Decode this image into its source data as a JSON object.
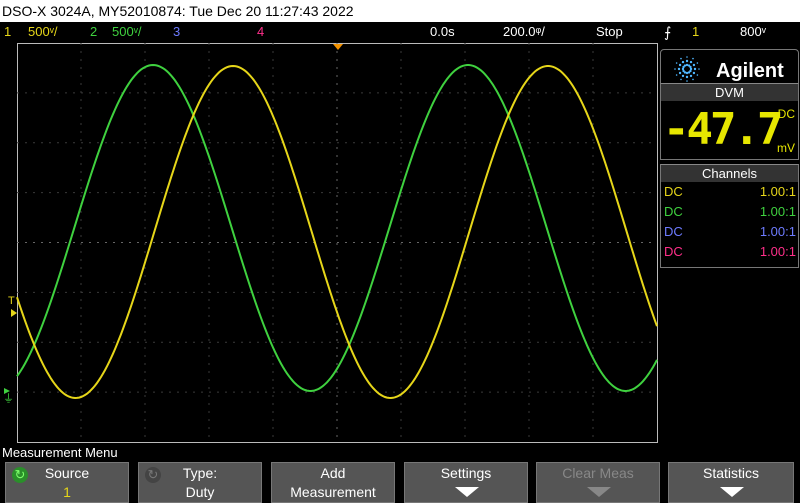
{
  "title": "DSO-X 3024A, MY52010874: Tue Dec 20 11:27:43 2022",
  "status": {
    "ch1_num": "1",
    "ch1_scale": "500ᵛ/",
    "ch2_num": "2",
    "ch2_scale": "500ᵛ/",
    "ch3_num": "3",
    "ch4_num": "4",
    "time_delay": "0.0s",
    "time_scale": "200.0ᵠ/",
    "run_state": "Stop",
    "trigger_source": "1",
    "trigger_level": "800ᵛ"
  },
  "markers": {
    "trigger_mark": "T",
    "ground_mark": "⏚"
  },
  "logo": {
    "brand": "Agilent"
  },
  "dvm": {
    "title": "DVM",
    "reading": "-47.7",
    "coupling": "DC",
    "unit": "mV"
  },
  "channels_panel": {
    "title": "Channels",
    "rows": [
      {
        "coupling": "DC",
        "ratio": "1.00:1",
        "color": "#e6d619"
      },
      {
        "coupling": "DC",
        "ratio": "1.00:1",
        "color": "#3fd13f"
      },
      {
        "coupling": "DC",
        "ratio": "1.00:1",
        "color": "#6d7bff"
      },
      {
        "coupling": "DC",
        "ratio": "1.00:1",
        "color": "#ff2f8a"
      }
    ]
  },
  "menu": {
    "title": "Measurement Menu",
    "softkeys": [
      {
        "line1": "Source",
        "line2": "1"
      },
      {
        "line1": "Type:",
        "line2": "Duty"
      },
      {
        "line1": "Add",
        "line2": "Measurement"
      },
      {
        "line1": "Settings",
        "line2": ""
      },
      {
        "line1": "Clear Meas",
        "line2": ""
      },
      {
        "line1": "Statistics",
        "line2": ""
      }
    ]
  },
  "colors": {
    "ch1": "#e6d619",
    "ch2": "#3fd13f",
    "ch3": "#6d7bff",
    "ch4": "#ff2f8a",
    "accent": "#f39200"
  }
}
